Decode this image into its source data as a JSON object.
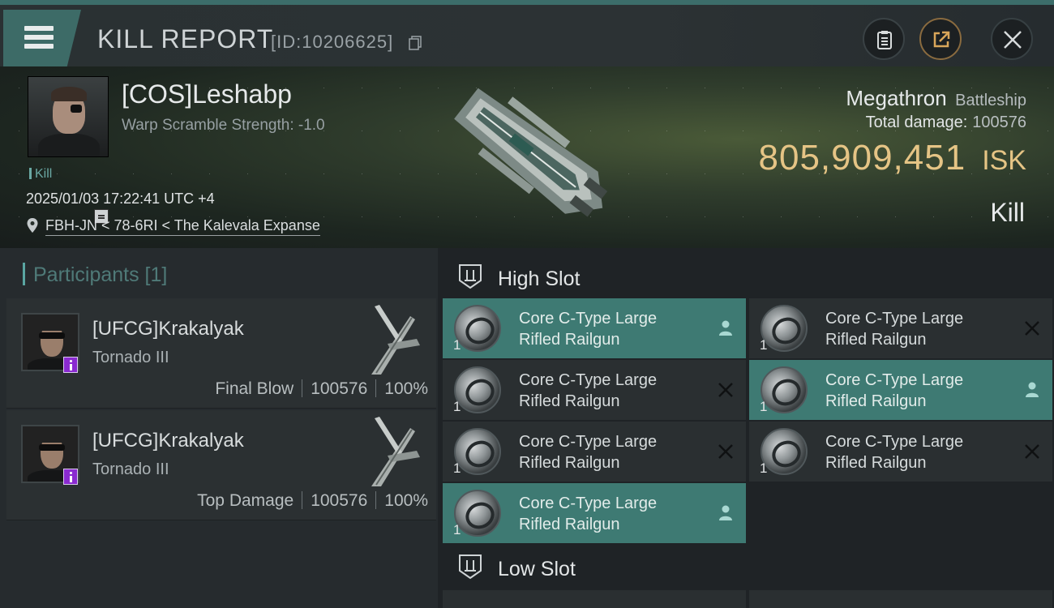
{
  "header": {
    "title": "KILL REPORT",
    "id_label": "[ID:10206625]",
    "icons": [
      "menu-icon",
      "copy-icon",
      "clipboard-icon",
      "share-icon",
      "close-icon"
    ]
  },
  "victim": {
    "name": "[COS]Leshabp",
    "subtitle": "Warp Scramble Strength: -1.0",
    "kill_tag": "Kill",
    "timestamp": "2025/01/03 17:22:41 UTC +4",
    "location": "FBH-JN < 78-6RI < The Kalevala Expanse"
  },
  "ship": {
    "name": "Megathron",
    "class": "Battleship",
    "damage_label": "Total damage:",
    "damage_value": "100576",
    "isk_value": "805,909,451",
    "isk_unit": "ISK",
    "result": "Kill"
  },
  "participants": {
    "title": "Participants [1]",
    "cards": [
      {
        "name": "[UFCG]Krakalyak",
        "ship": "Tornado III",
        "role": "Final Blow",
        "damage": "100576",
        "percent": "100%"
      },
      {
        "name": "[UFCG]Krakalyak",
        "ship": "Tornado III",
        "role": "Top Damage",
        "damage": "100576",
        "percent": "100%"
      }
    ]
  },
  "slots": {
    "high": {
      "title": "High Slot",
      "modules": [
        {
          "line1": "Core C-Type Large",
          "line2": "Rifled Railgun",
          "qty": "1",
          "status": "dropped"
        },
        {
          "line1": "Core C-Type Large",
          "line2": "Rifled Railgun",
          "qty": "1",
          "status": "destroyed"
        },
        {
          "line1": "Core C-Type Large",
          "line2": "Rifled Railgun",
          "qty": "1",
          "status": "destroyed"
        },
        {
          "line1": "Core C-Type Large",
          "line2": "Rifled Railgun",
          "qty": "1",
          "status": "dropped"
        },
        {
          "line1": "Core C-Type Large",
          "line2": "Rifled Railgun",
          "qty": "1",
          "status": "destroyed"
        },
        {
          "line1": "Core C-Type Large",
          "line2": "Rifled Railgun",
          "qty": "1",
          "status": "destroyed"
        },
        {
          "line1": "Core C-Type Large",
          "line2": "Rifled Railgun",
          "qty": "1",
          "status": "dropped"
        }
      ]
    },
    "low": {
      "title": "Low Slot"
    }
  },
  "colors": {
    "accent": "#3e7a73",
    "isk": "#e5c485",
    "background": "#1f2326"
  }
}
